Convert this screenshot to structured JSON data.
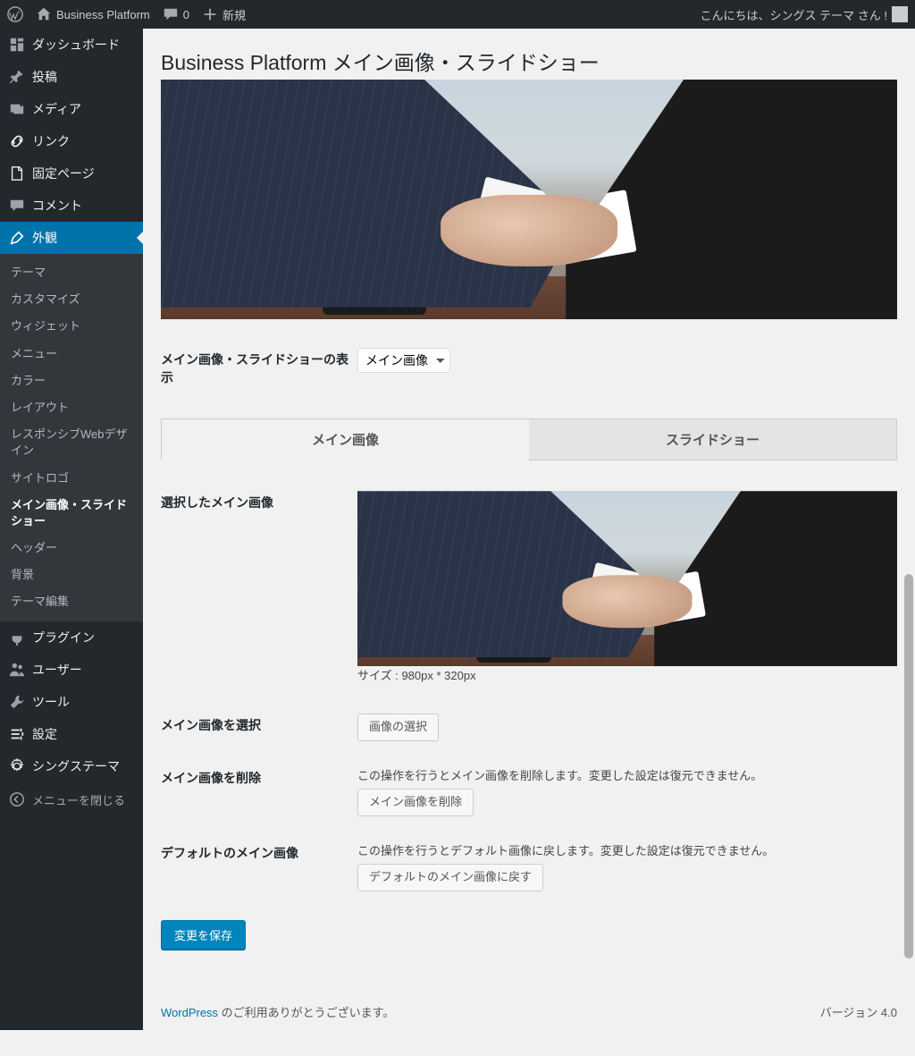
{
  "adminbar": {
    "site_name": "Business Platform",
    "comments_count": "0",
    "new_label": "新規",
    "greeting": "こんにちは、シングス テーマ さん !"
  },
  "sidebar": {
    "items": [
      {
        "label": "ダッシュボード",
        "icon": "dashboard"
      },
      {
        "label": "投稿",
        "icon": "pin"
      },
      {
        "label": "メディア",
        "icon": "media"
      },
      {
        "label": "リンク",
        "icon": "link"
      },
      {
        "label": "固定ページ",
        "icon": "page"
      },
      {
        "label": "コメント",
        "icon": "comment"
      },
      {
        "label": "外観",
        "icon": "appearance",
        "current": true
      },
      {
        "label": "プラグイン",
        "icon": "plugin"
      },
      {
        "label": "ユーザー",
        "icon": "users"
      },
      {
        "label": "ツール",
        "icon": "tools"
      },
      {
        "label": "設定",
        "icon": "settings"
      },
      {
        "label": "シングステーマ",
        "icon": "gear"
      }
    ],
    "submenu": [
      "テーマ",
      "カスタマイズ",
      "ウィジェット",
      "メニュー",
      "カラー",
      "レイアウト",
      "レスポンシブWebデザイン",
      "サイトロゴ",
      "メイン画像・スライドショー",
      "ヘッダー",
      "背景",
      "テーマ編集"
    ],
    "submenu_current_index": 8,
    "collapse_label": "メニューを閉じる"
  },
  "page": {
    "title": "Business Platform メイン画像・スライドショー",
    "display_mode_label": "メイン画像・スライドショーの表示",
    "display_mode_value": "メイン画像",
    "tabs": [
      "メイン画像",
      "スライドショー"
    ],
    "selected_label": "選択したメイン画像",
    "size_label": "サイズ : 980px * 320px",
    "select_label": "メイン画像を選択",
    "select_button": "画像の選択",
    "delete_label": "メイン画像を削除",
    "delete_desc": "この操作を行うとメイン画像を削除します。変更した設定は復元できません。",
    "delete_button": "メイン画像を削除",
    "default_label": "デフォルトのメイン画像",
    "default_desc": "この操作を行うとデフォルト画像に戻します。変更した設定は復元できません。",
    "default_button": "デフォルトのメイン画像に戻す",
    "save_button": "変更を保存"
  },
  "footer": {
    "wp_link": "WordPress",
    "thanks": " のご利用ありがとうございます。",
    "version": "バージョン 4.0"
  }
}
